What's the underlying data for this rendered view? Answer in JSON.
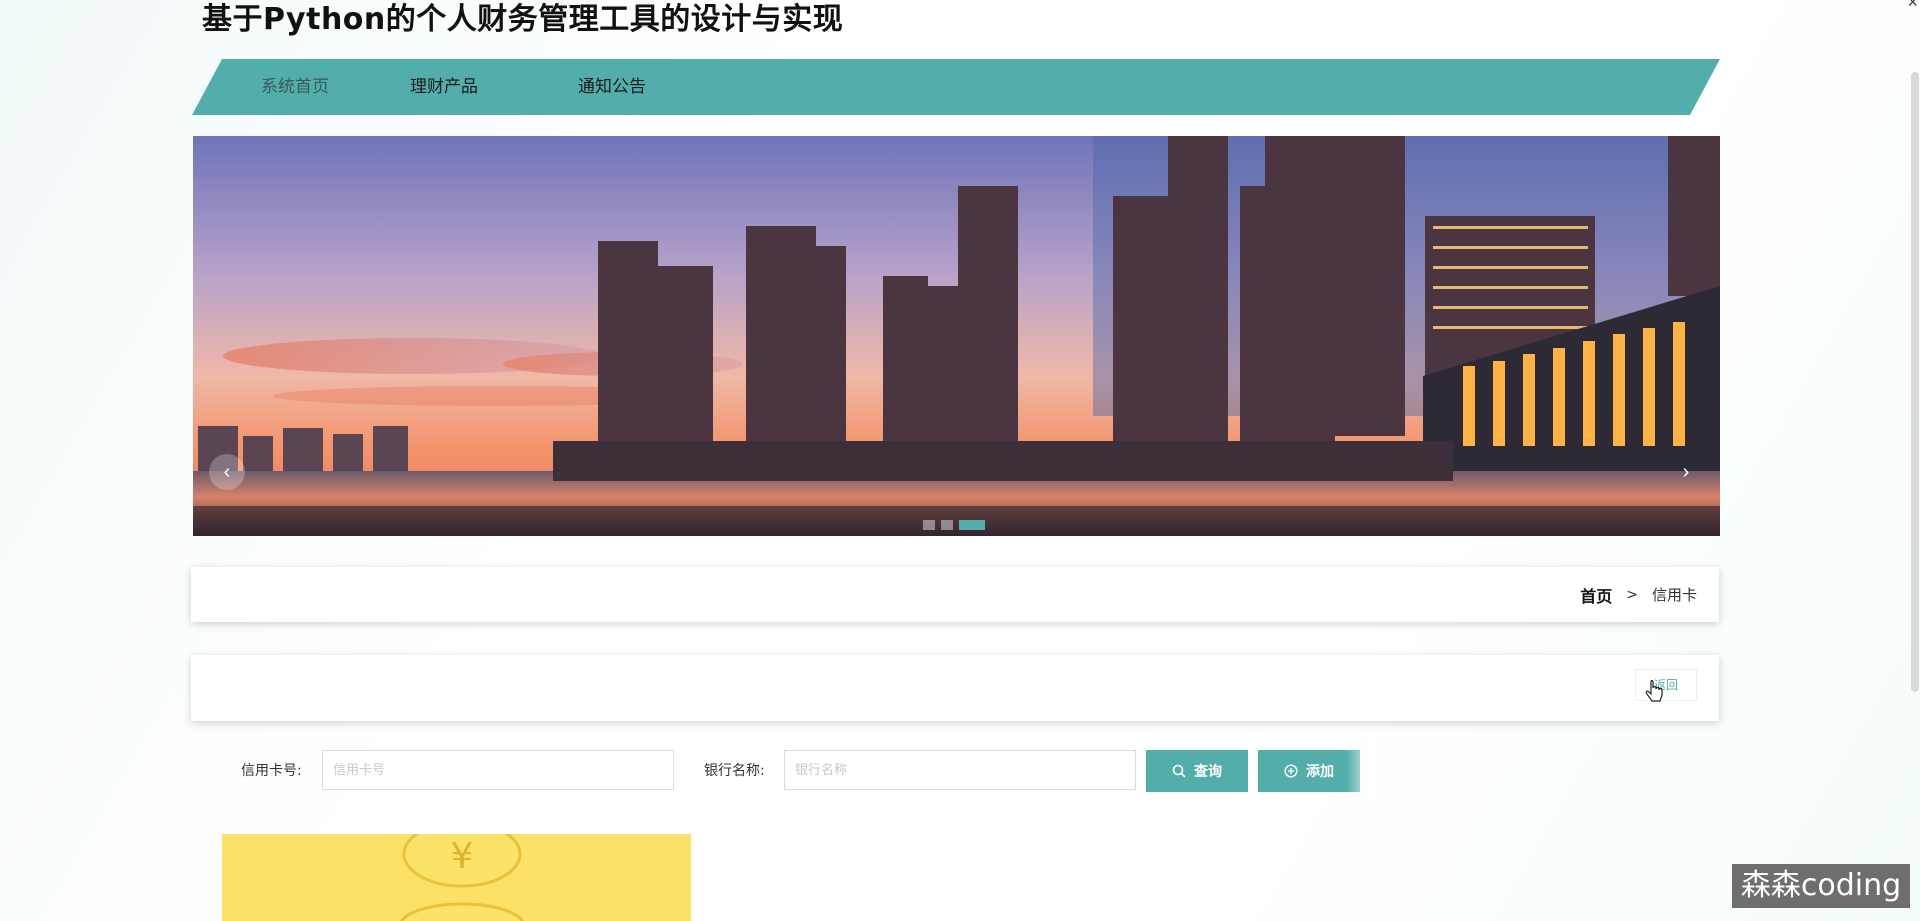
{
  "app": {
    "title": "基于Python的个人财务管理工具的设计与实现"
  },
  "nav": {
    "items": [
      {
        "label": "系统首页"
      },
      {
        "label": "理财产品"
      },
      {
        "label": "通知公告"
      }
    ],
    "color": "#53aeab"
  },
  "banner": {
    "prev_icon": "chevron-left-icon",
    "next_icon": "chevron-right-icon",
    "active_slide": 3,
    "slide_count": 3
  },
  "breadcrumb": {
    "home": "首页",
    "separator": ">",
    "current": "信用卡"
  },
  "actions": {
    "back_label": "返回"
  },
  "search": {
    "card_label": "信用卡号:",
    "card_placeholder": "信用卡号",
    "bank_label": "银行名称:",
    "bank_placeholder": "银行名称",
    "query_label": "查询",
    "query_icon": "search-icon",
    "add_label": "添加",
    "add_icon": "plus-circle-icon"
  },
  "watermark": "森森coding",
  "colors": {
    "accent": "#53aeab",
    "card_yellow": "#f9d84a"
  }
}
